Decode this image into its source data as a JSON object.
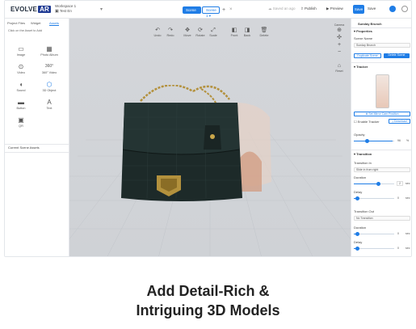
{
  "app": {
    "logo_text": "EVOLVE",
    "logo_badge": "AR",
    "workspace_line1": "Workspace 1",
    "workspace_line2": "Test En"
  },
  "scene_tabs": [
    {
      "label": "Scene 01",
      "active": true
    },
    {
      "label": "Scene 1",
      "active": false
    }
  ],
  "topbar": {
    "saved_text": "Saved an ago",
    "publish_label": "Publish",
    "preview_label": "Preview",
    "save_label": "Save",
    "save_as_label": "Save"
  },
  "left_panel": {
    "tabs": [
      "Project Files",
      "Widget",
      "Assets"
    ],
    "active_tab": "Assets",
    "hint": "Click on the Asset to Add",
    "assets": [
      {
        "label": "Image",
        "icon": "image-icon"
      },
      {
        "label": "Photo Album",
        "icon": "photo-album-icon"
      },
      {
        "label": "Video",
        "icon": "video-icon"
      },
      {
        "label": "360° Video",
        "icon": "video-360-icon"
      },
      {
        "label": "Sound",
        "icon": "sound-icon"
      },
      {
        "label": "3D Object",
        "icon": "cube-icon"
      },
      {
        "label": "Button",
        "icon": "button-icon"
      },
      {
        "label": "Text",
        "icon": "text-icon"
      },
      {
        "label": "QR",
        "icon": "qr-icon"
      }
    ],
    "footer": "Current Scene Assets"
  },
  "toolbar": [
    {
      "label": "Undo",
      "icon": "undo-icon"
    },
    {
      "label": "Redo",
      "icon": "redo-icon"
    },
    {
      "label": "Move",
      "icon": "move-icon"
    },
    {
      "label": "Rotate",
      "icon": "rotate-icon"
    },
    {
      "label": "Scale",
      "icon": "scale-icon"
    },
    {
      "label": "Front",
      "icon": "front-icon"
    },
    {
      "label": "Back",
      "icon": "back-icon"
    },
    {
      "label": "Delete",
      "icon": "delete-icon"
    }
  ],
  "right_tools": {
    "label": "Camera",
    "reset": "Reset"
  },
  "right_panel": {
    "title": "Sunday Brunch",
    "properties_label": "Properties",
    "scene_name_label": "Scene Name",
    "scene_name_value": "Sunday Brunch",
    "duplicate_label": "Duplicate Scene",
    "delete_label": "Delete Scene",
    "tracker_label": "Tracker",
    "set_camera_label": "Set Mirror Cam Position",
    "enable_tracker_label": "Enable Tracker",
    "download_label": "Download",
    "opacity_label": "Opacity",
    "opacity_value": "96",
    "opacity_unit": "%",
    "opacity_fraction": 0.96,
    "transition_label": "Transition",
    "transition_in_label": "Transition In",
    "transition_in_value": "Slide in from right",
    "duration_label": "Duration",
    "duration_value": "2",
    "duration_unit": "sec",
    "delay_label": "Delay",
    "delay_value": "0",
    "delay_unit": "sec",
    "transition_out_label": "Transition Out",
    "transition_out_value": "No Transition",
    "duration2_value": "0",
    "delay2_value": "0"
  },
  "caption": {
    "line1": "Add Detail-Rich &",
    "line2": "Intriguing 3D Models"
  },
  "colors": {
    "accent": "#1f7de6",
    "canvas_bg": "#d2d4d8",
    "bag": "#1d2a29"
  }
}
